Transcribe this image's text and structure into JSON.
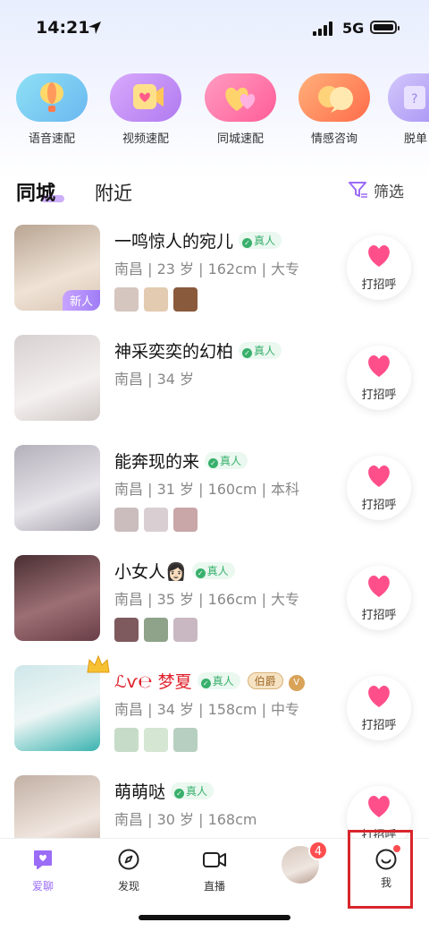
{
  "status": {
    "time": "14:21",
    "network": "5G"
  },
  "features": [
    {
      "label": "语音速配",
      "color": "#7ad3f2",
      "icon": "balloon-icon"
    },
    {
      "label": "视频速配",
      "color": "#c79cf5",
      "icon": "video-icon"
    },
    {
      "label": "同城速配",
      "color": "#ff79a8",
      "icon": "hearts-icon"
    },
    {
      "label": "情感咨询",
      "color": "#ff8a5b",
      "icon": "chat-bubbles-icon"
    },
    {
      "label": "脱单",
      "color": "#b9a7f7",
      "icon": "question-icon"
    }
  ],
  "tabs": {
    "active": "同城",
    "other": "附近",
    "filter": "筛选"
  },
  "users": [
    {
      "name": "一鸣惊人的宛儿",
      "verified": "真人",
      "info": "南昌 | 23 岁 | 162cm | 大专",
      "tag": "新人",
      "photos": 3,
      "greet": "打招呼",
      "avatar_colors": [
        "#c9b8a7",
        "#eadfd4"
      ]
    },
    {
      "name": "神采奕奕的幻柏",
      "verified": "真人",
      "info": "南昌 | 34 岁",
      "photos": 0,
      "greet": "打招呼",
      "avatar_colors": [
        "#d8d4d4",
        "#f2efee"
      ]
    },
    {
      "name": "能奔现的来",
      "verified": "真人",
      "info": "南昌 | 31 岁 | 160cm | 本科",
      "photos": 3,
      "greet": "打招呼",
      "avatar_colors": [
        "#b9b7c2",
        "#e4e2e8"
      ]
    },
    {
      "name": "小女人👩🏻",
      "verified": "真人",
      "info": "南昌 | 35 岁 | 166cm | 大专",
      "photos": 3,
      "greet": "打招呼",
      "avatar_colors": [
        "#5a3b3e",
        "#b98a8f"
      ]
    },
    {
      "name": "ℒѵ℮ 梦夏",
      "verified": "真人",
      "info": "南昌 | 34 岁 | 158cm | 中专",
      "badge": "伯爵",
      "photos": 3,
      "greet": "打招呼",
      "avatar_colors": [
        "#7fc7c5",
        "#e7f3f2"
      ]
    },
    {
      "name": "萌萌哒",
      "verified": "真人",
      "info": "南昌 | 30 岁 | 168cm",
      "photos": 0,
      "greet": "打招呼",
      "avatar_colors": [
        "#c5b3a8",
        "#f0e6df"
      ]
    }
  ],
  "nav": [
    {
      "label": "爱聊",
      "icon": "chat-heart-icon",
      "active": true
    },
    {
      "label": "发现",
      "icon": "compass-icon"
    },
    {
      "label": "直播",
      "icon": "camera-icon"
    },
    {
      "label": "",
      "icon": "avatar",
      "badge": "4"
    },
    {
      "label": "我",
      "icon": "smile-icon"
    }
  ],
  "colors": {
    "accent": "#9b6cf6",
    "highlight": "#d8262c",
    "heart": "#ff4f8b"
  }
}
